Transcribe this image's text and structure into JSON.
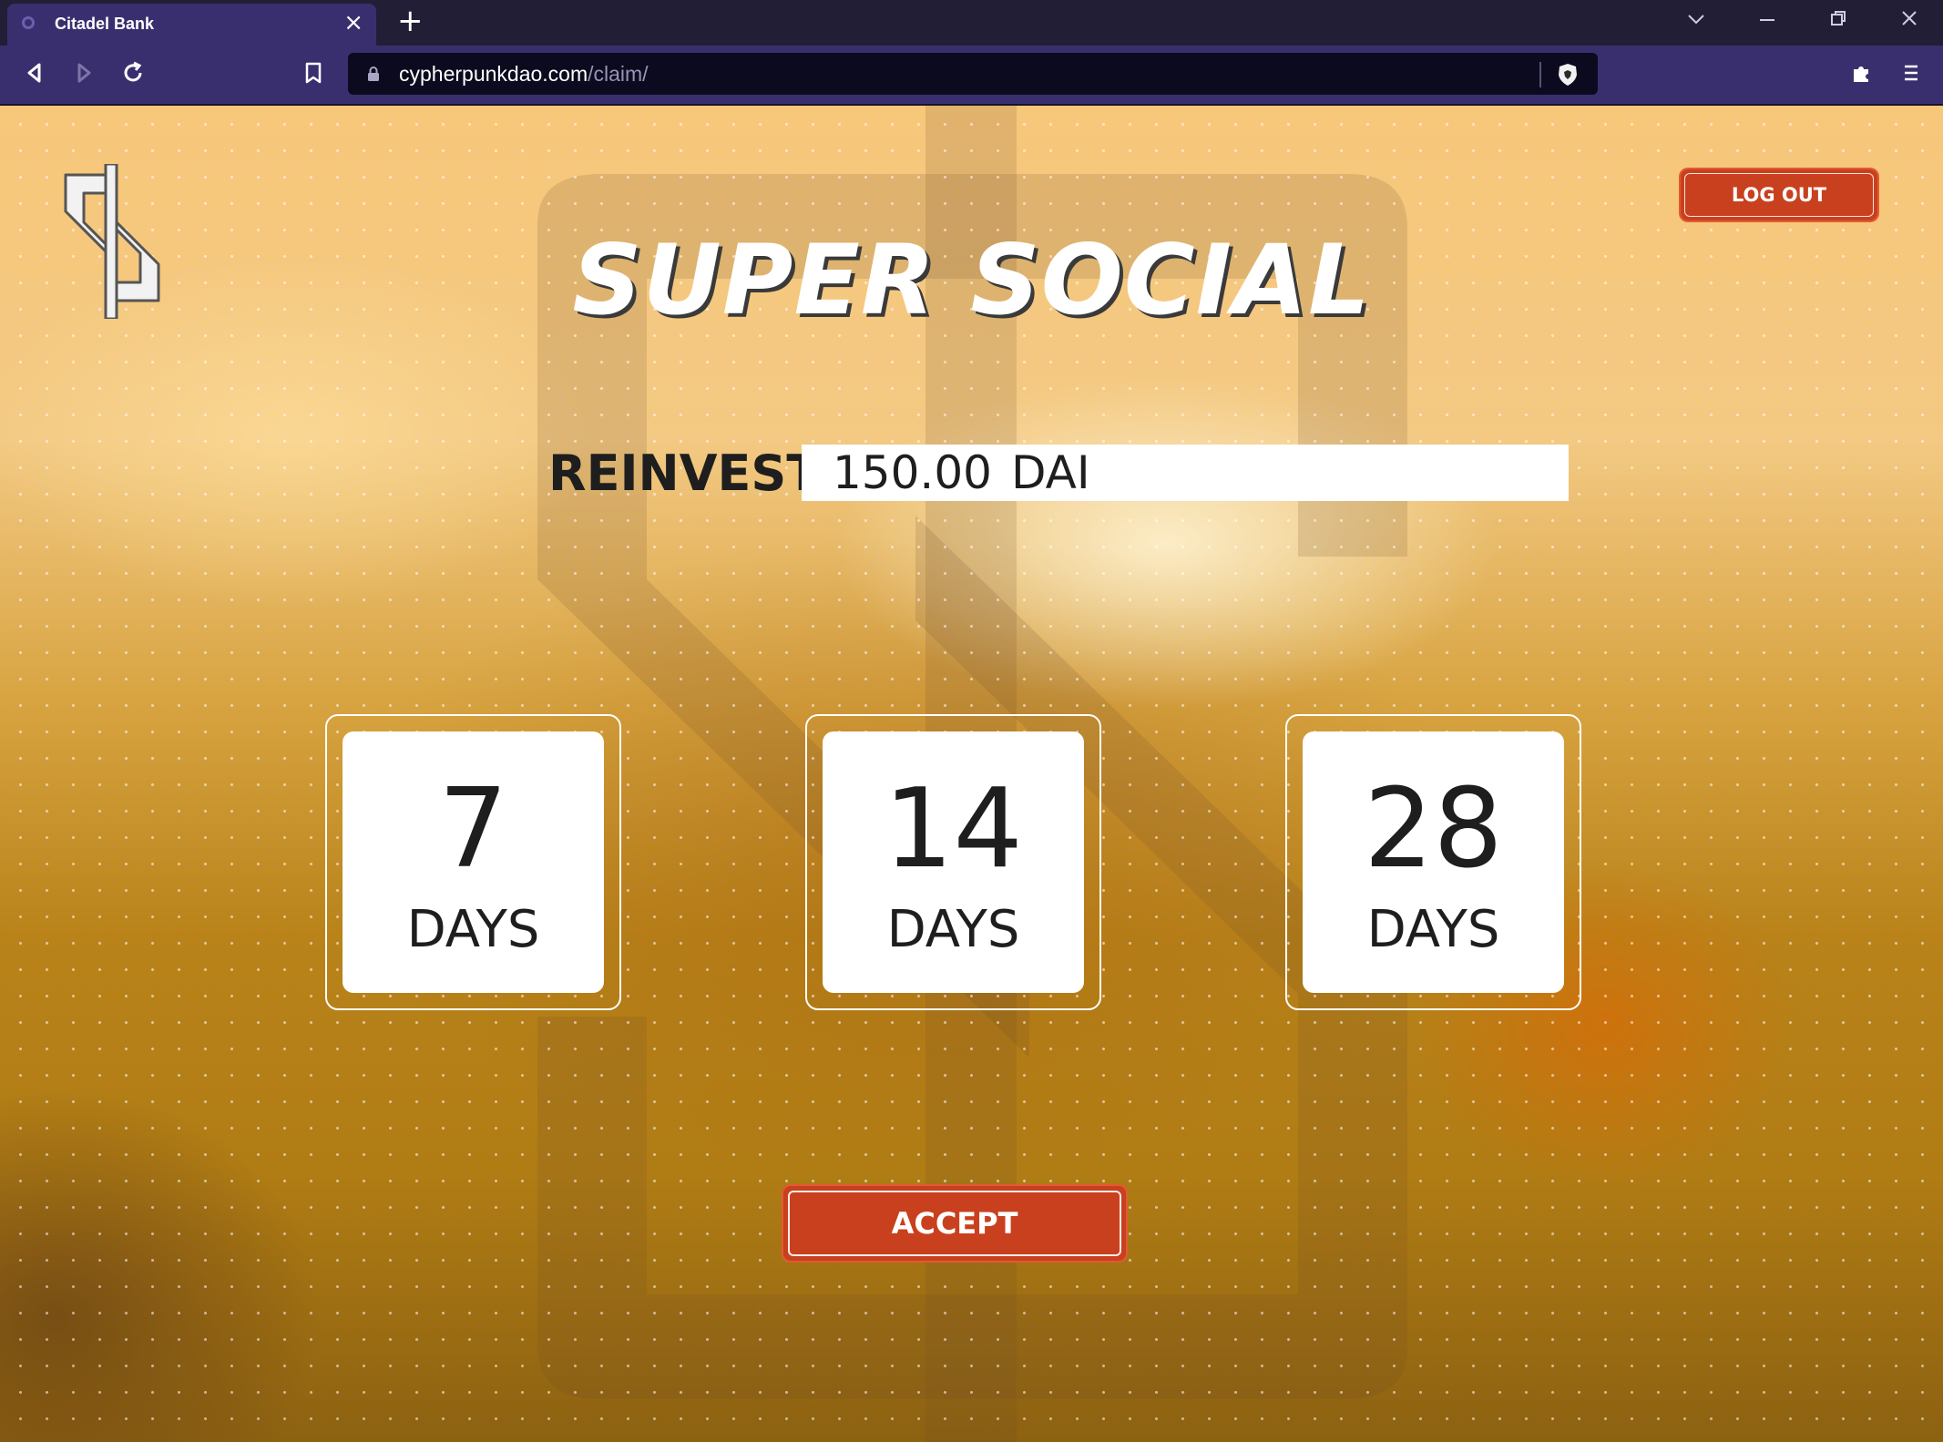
{
  "browser": {
    "tab_title": "Citadel Bank",
    "tab_close_icon": "×",
    "new_tab_icon": "+",
    "url_domain": "cypherpunkdao.com",
    "url_path": "/claim/",
    "accent_color": "#3a2f6e"
  },
  "page": {
    "logout_label": "LOG OUT",
    "title": "SUPER SOCIAL",
    "reinvest_label": "REINVEST",
    "reinvest_amount": "150.00",
    "reinvest_currency": "DAI",
    "options": [
      {
        "number": "7",
        "unit": "DAYS"
      },
      {
        "number": "14",
        "unit": "DAYS"
      },
      {
        "number": "28",
        "unit": "DAYS"
      }
    ],
    "accept_label": "ACCEPT",
    "button_color": "#c9401e"
  }
}
